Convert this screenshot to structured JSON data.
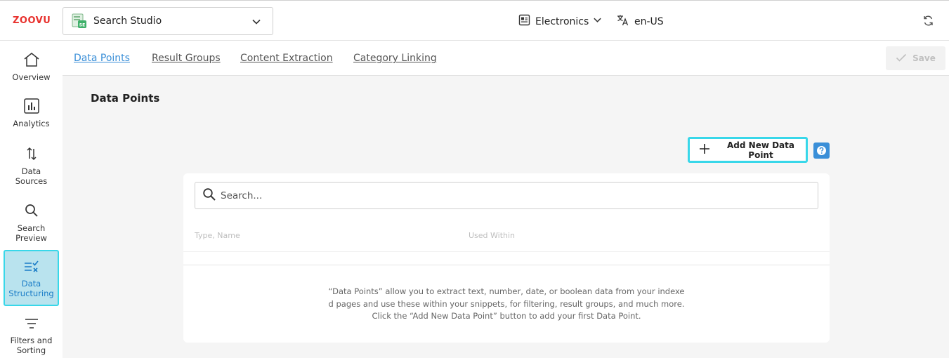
{
  "header": {
    "logo_text": "ZOOVU",
    "product": {
      "label": "Search Studio",
      "icon": "search-studio-icon"
    },
    "catalog": {
      "label": "Electronics",
      "icon": "catalog-icon"
    },
    "locale": {
      "label": "en-US",
      "icon": "translate-icon"
    },
    "refresh_icon": "refresh-icon"
  },
  "sidebar": {
    "items": [
      {
        "label_line1": "Overview",
        "label_line2": "",
        "icon": "home-icon"
      },
      {
        "label_line1": "Analytics",
        "label_line2": "",
        "icon": "analytics-icon"
      },
      {
        "label_line1": "Data",
        "label_line2": "Sources",
        "icon": "sort-arrows-icon"
      },
      {
        "label_line1": "Search",
        "label_line2": "Preview",
        "icon": "search-icon"
      },
      {
        "label_line1": "Data",
        "label_line2": "Structuring",
        "icon": "list-check-icon",
        "active": true
      },
      {
        "label_line1": "Filters and",
        "label_line2": "Sorting",
        "icon": "filter-icon"
      }
    ]
  },
  "tabs": [
    {
      "label": "Data Points",
      "active": true
    },
    {
      "label": "Result Groups"
    },
    {
      "label": "Content Extraction"
    },
    {
      "label": "Category Linking"
    }
  ],
  "toolbar": {
    "save_label": "Save"
  },
  "main": {
    "title": "Data Points",
    "add_button_label": "Add New Data Point",
    "search_placeholder": "Search...",
    "columns": [
      "Type, Name",
      "Used Within"
    ],
    "empty_lines": [
      "“Data Points” allow you to extract text, number, date, or boolean data from your indexe",
      "d pages and use these within your snippets, for filtering, result groups, and much more.",
      "Click the “Add New Data Point” button to add your first Data Point."
    ]
  },
  "colors": {
    "accent": "#3a8fd8",
    "highlight_border": "#38d7e9",
    "brand_red": "#e8322e",
    "active_bg": "#b9e3ee"
  }
}
